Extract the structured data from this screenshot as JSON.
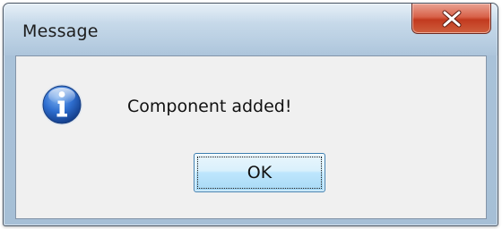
{
  "window": {
    "title": "Message"
  },
  "titlebar": {
    "close_icon": "close-icon",
    "close_color": "#c7432a"
  },
  "dialog": {
    "icon": "info-icon",
    "icon_color": "#1f5bb0",
    "message": "Component added!",
    "ok_label": "OK"
  }
}
